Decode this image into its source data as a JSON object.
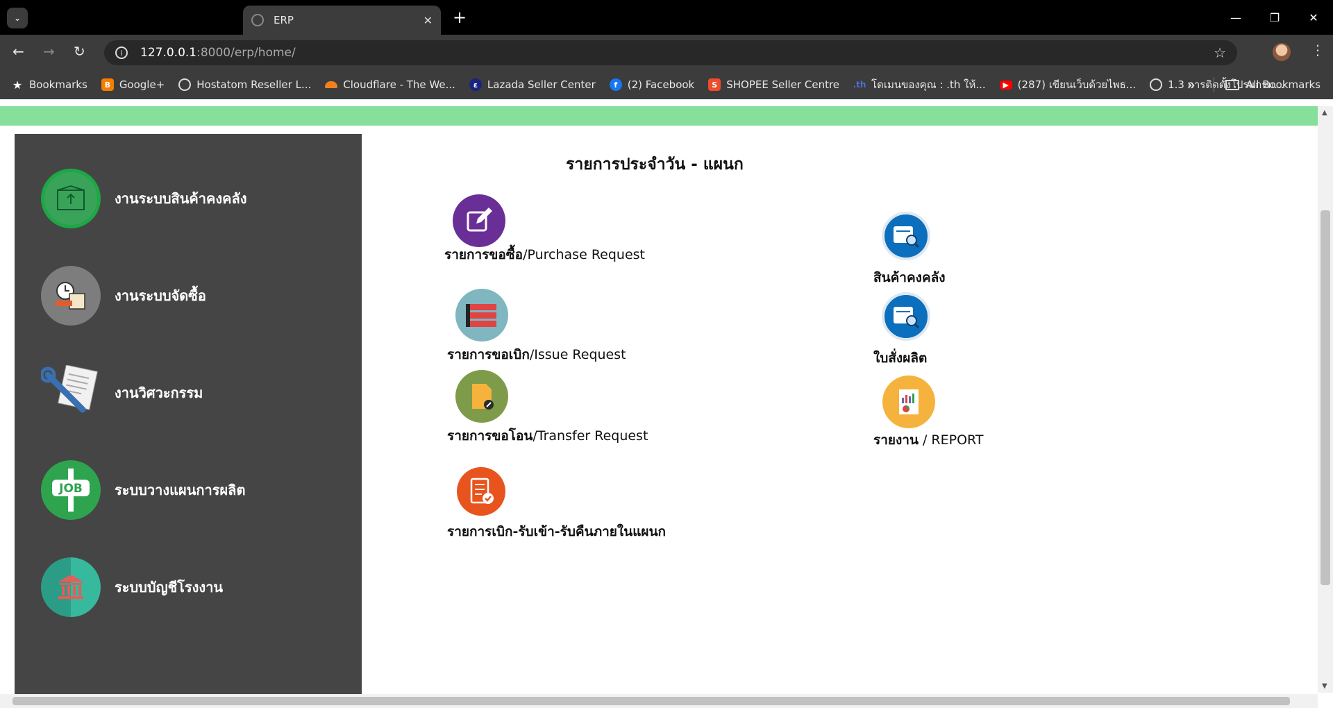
{
  "browser": {
    "tab_title": "ERP",
    "url_host": "127.0.0.1",
    "url_path": ":8000/erp/home/",
    "bookmarks": [
      {
        "label": "Bookmarks",
        "icon": "star-icon"
      },
      {
        "label": "Google+",
        "icon": "blogger-icon"
      },
      {
        "label": "Hostatom Reseller L...",
        "icon": "globe-icon"
      },
      {
        "label": "Cloudflare - The We...",
        "icon": "cloudflare-icon"
      },
      {
        "label": "Lazada Seller Center",
        "icon": "lazada-icon"
      },
      {
        "label": "(2) Facebook",
        "icon": "facebook-icon"
      },
      {
        "label": "SHOPEE Seller Centre",
        "icon": "shopee-icon"
      },
      {
        "label": "โดเมนของคุณ : .th ให้...",
        "icon": "th-icon"
      },
      {
        "label": "(287) เขียนเว็บด้วยไพธ...",
        "icon": "youtube-icon"
      },
      {
        "label": "1.3 การติดตั้งโปรแกรม...",
        "icon": "globe-icon"
      }
    ],
    "all_bookmarks": "All Bookmarks",
    "more_bookmarks": "»"
  },
  "sidebar": {
    "items": [
      {
        "label": "งานระบบสินค้าคงคลัง",
        "icon": "warehouse-box-icon"
      },
      {
        "label": "งานระบบจัดซื้อ",
        "icon": "purchasing-icon"
      },
      {
        "label": "งานวิศวะกรรม",
        "icon": "engineering-wrench-icon"
      },
      {
        "label": "ระบบวางแผนการผลิต",
        "icon": "job-sign-icon"
      },
      {
        "label": "ระบบบัญชีโรงงาน",
        "icon": "bank-icon"
      }
    ]
  },
  "main": {
    "title": "รายการประจำวัน - แผนก",
    "left_items": [
      {
        "thai": "รายการขอซื้อ",
        "eng": "/Purchase Request",
        "icon": "edit-icon"
      },
      {
        "thai": "รายการขอเบิก",
        "eng": "/Issue Request",
        "icon": "list-icon"
      },
      {
        "thai": "รายการขอโอน",
        "eng": "/Transfer Request",
        "icon": "document-icon"
      },
      {
        "thai": "รายการเบิก-รับเข้า-รับคืนภายในแผนก",
        "eng": "",
        "icon": "checklist-icon"
      }
    ],
    "right_items": [
      {
        "thai": "สินค้าคงคลัง",
        "eng": "",
        "icon": "search-card-icon"
      },
      {
        "thai": "ใบสั่งผลิต",
        "eng": "",
        "icon": "search-card-icon"
      },
      {
        "thai": "รายงาน",
        "eng": " / REPORT",
        "icon": "report-chart-icon"
      }
    ]
  },
  "colors": {
    "green_bar": "#86df9b",
    "sidebar_bg": "#454545",
    "purple": "#6a2f97",
    "blue": "#0b6fbd",
    "orange": "#e8541d",
    "report_yellow": "#f5b23c"
  }
}
